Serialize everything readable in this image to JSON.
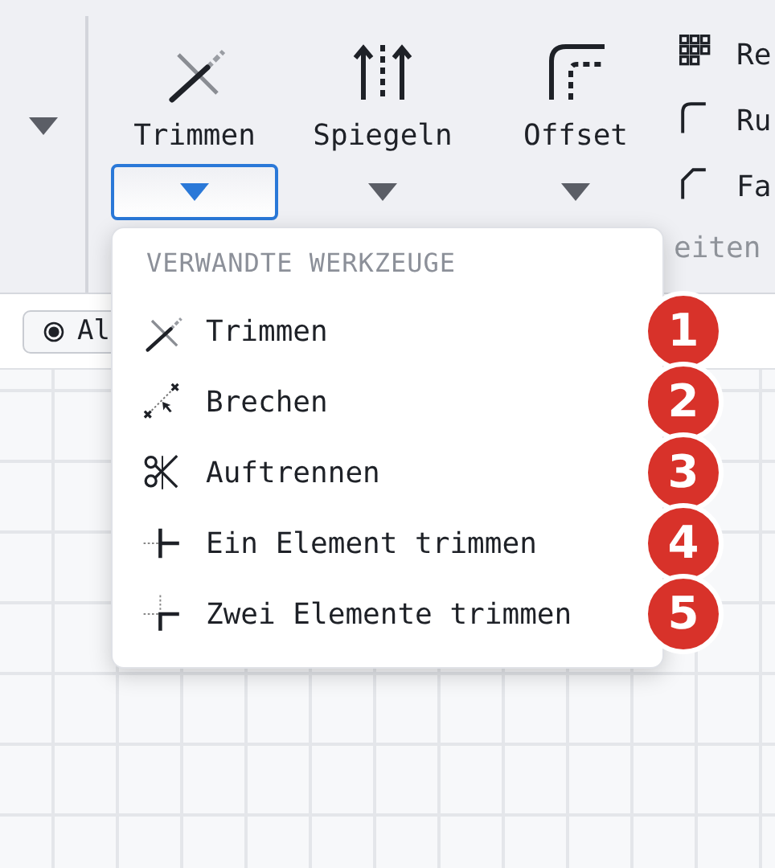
{
  "ribbon": {
    "tools": [
      {
        "kind": "trim",
        "label": "Trimmen",
        "selected": true
      },
      {
        "kind": "mirror",
        "label": "Spiegeln",
        "selected": false
      },
      {
        "kind": "offset",
        "label": "Offset",
        "selected": false
      }
    ],
    "small_tools": [
      {
        "kind": "grid",
        "label": "Re"
      },
      {
        "kind": "fillet",
        "label": "Ru"
      },
      {
        "kind": "chamfer",
        "label": "Fa"
      }
    ],
    "group_label": "eiten"
  },
  "toolbar": {
    "chip": {
      "label": "Al"
    }
  },
  "menu": {
    "header": "VERWANDTE WERKZEUGE",
    "items": [
      {
        "kind": "trim",
        "label": "Trimmen",
        "badge": "1"
      },
      {
        "kind": "break",
        "label": "Brechen",
        "badge": "2"
      },
      {
        "kind": "split",
        "label": "Auftrennen",
        "badge": "3"
      },
      {
        "kind": "trim-one",
        "label": "Ein Element trimmen",
        "badge": "4"
      },
      {
        "kind": "trim-two",
        "label": "Zwei Elemente trimmen",
        "badge": "5"
      }
    ]
  }
}
